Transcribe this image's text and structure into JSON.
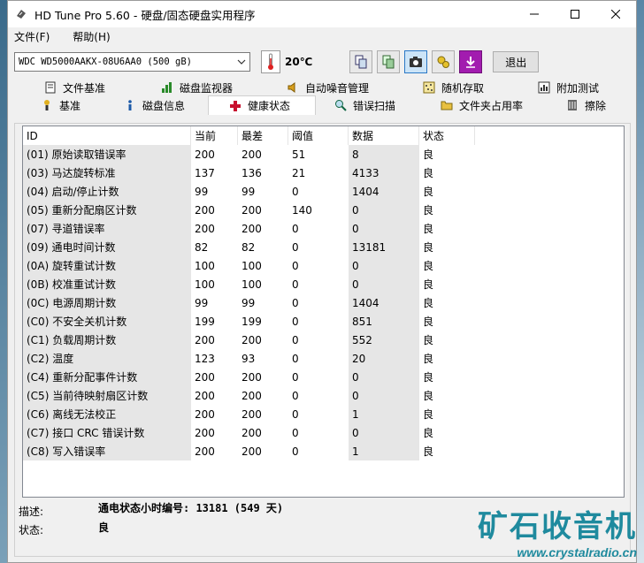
{
  "window": {
    "title": "HD Tune Pro 5.60 - 硬盘/固态硬盘实用程序"
  },
  "menu": [
    {
      "label": "文件(F)"
    },
    {
      "label": "帮助(H)"
    }
  ],
  "toolbar": {
    "drive": "WDC WD5000AAKX-08U6AA0 (500 gB)",
    "temperature": "20℃",
    "exit_label": "退出"
  },
  "tabs_top": [
    {
      "label": "文件基准",
      "icon": "file-benchmark-icon"
    },
    {
      "label": "磁盘监视器",
      "icon": "disk-monitor-icon"
    },
    {
      "label": "自动噪音管理",
      "icon": "speaker-icon"
    },
    {
      "label": "随机存取",
      "icon": "random-access-icon"
    },
    {
      "label": "附加测试",
      "icon": "extra-tests-icon"
    }
  ],
  "tabs_bottom": [
    {
      "label": "基准",
      "icon": "benchmark-icon"
    },
    {
      "label": "磁盘信息",
      "icon": "info-icon"
    },
    {
      "label": "健康状态",
      "icon": "health-cross-icon",
      "selected": true
    },
    {
      "label": "错误扫描",
      "icon": "error-scan-icon"
    },
    {
      "label": "文件夹占用率",
      "icon": "folder-icon"
    },
    {
      "label": "擦除",
      "icon": "erase-icon"
    }
  ],
  "table": {
    "headers": [
      "ID",
      "当前",
      "最差",
      "阈值",
      "数据",
      "状态"
    ],
    "rows": [
      [
        "(01) 原始读取错误率",
        "200",
        "200",
        "51",
        "8",
        "良"
      ],
      [
        "(03) 马达旋转标准",
        "137",
        "136",
        "21",
        "4133",
        "良"
      ],
      [
        "(04) 启动/停止计数",
        "99",
        "99",
        "0",
        "1404",
        "良"
      ],
      [
        "(05) 重新分配扇区计数",
        "200",
        "200",
        "140",
        "0",
        "良"
      ],
      [
        "(07) 寻道错误率",
        "200",
        "200",
        "0",
        "0",
        "良"
      ],
      [
        "(09) 通电时间计数",
        "82",
        "82",
        "0",
        "13181",
        "良"
      ],
      [
        "(0A) 旋转重试计数",
        "100",
        "100",
        "0",
        "0",
        "良"
      ],
      [
        "(0B) 校准重试计数",
        "100",
        "100",
        "0",
        "0",
        "良"
      ],
      [
        "(0C) 电源周期计数",
        "99",
        "99",
        "0",
        "1404",
        "良"
      ],
      [
        "(C0) 不安全关机计数",
        "199",
        "199",
        "0",
        "851",
        "良"
      ],
      [
        "(C1) 负载周期计数",
        "200",
        "200",
        "0",
        "552",
        "良"
      ],
      [
        "(C2) 温度",
        "123",
        "93",
        "0",
        "20",
        "良"
      ],
      [
        "(C4) 重新分配事件计数",
        "200",
        "200",
        "0",
        "0",
        "良"
      ],
      [
        "(C5) 当前待映射扇区计数",
        "200",
        "200",
        "0",
        "0",
        "良"
      ],
      [
        "(C6) 离线无法校正",
        "200",
        "200",
        "0",
        "1",
        "良"
      ],
      [
        "(C7) 接口 CRC 错误计数",
        "200",
        "200",
        "0",
        "0",
        "良"
      ],
      [
        "(C8) 写入错误率",
        "200",
        "200",
        "0",
        "1",
        "良"
      ]
    ]
  },
  "description": {
    "desc_label": "描述:",
    "desc_value": "通电状态小时编号: 13181 (549 天)",
    "status_label": "状态:",
    "status_value": "良"
  },
  "watermark": {
    "main": "矿石收音机",
    "url": "www.crystalradio.cn"
  },
  "colors": {
    "accent": "#1f8a9e",
    "health_cross": "#c8102e"
  }
}
